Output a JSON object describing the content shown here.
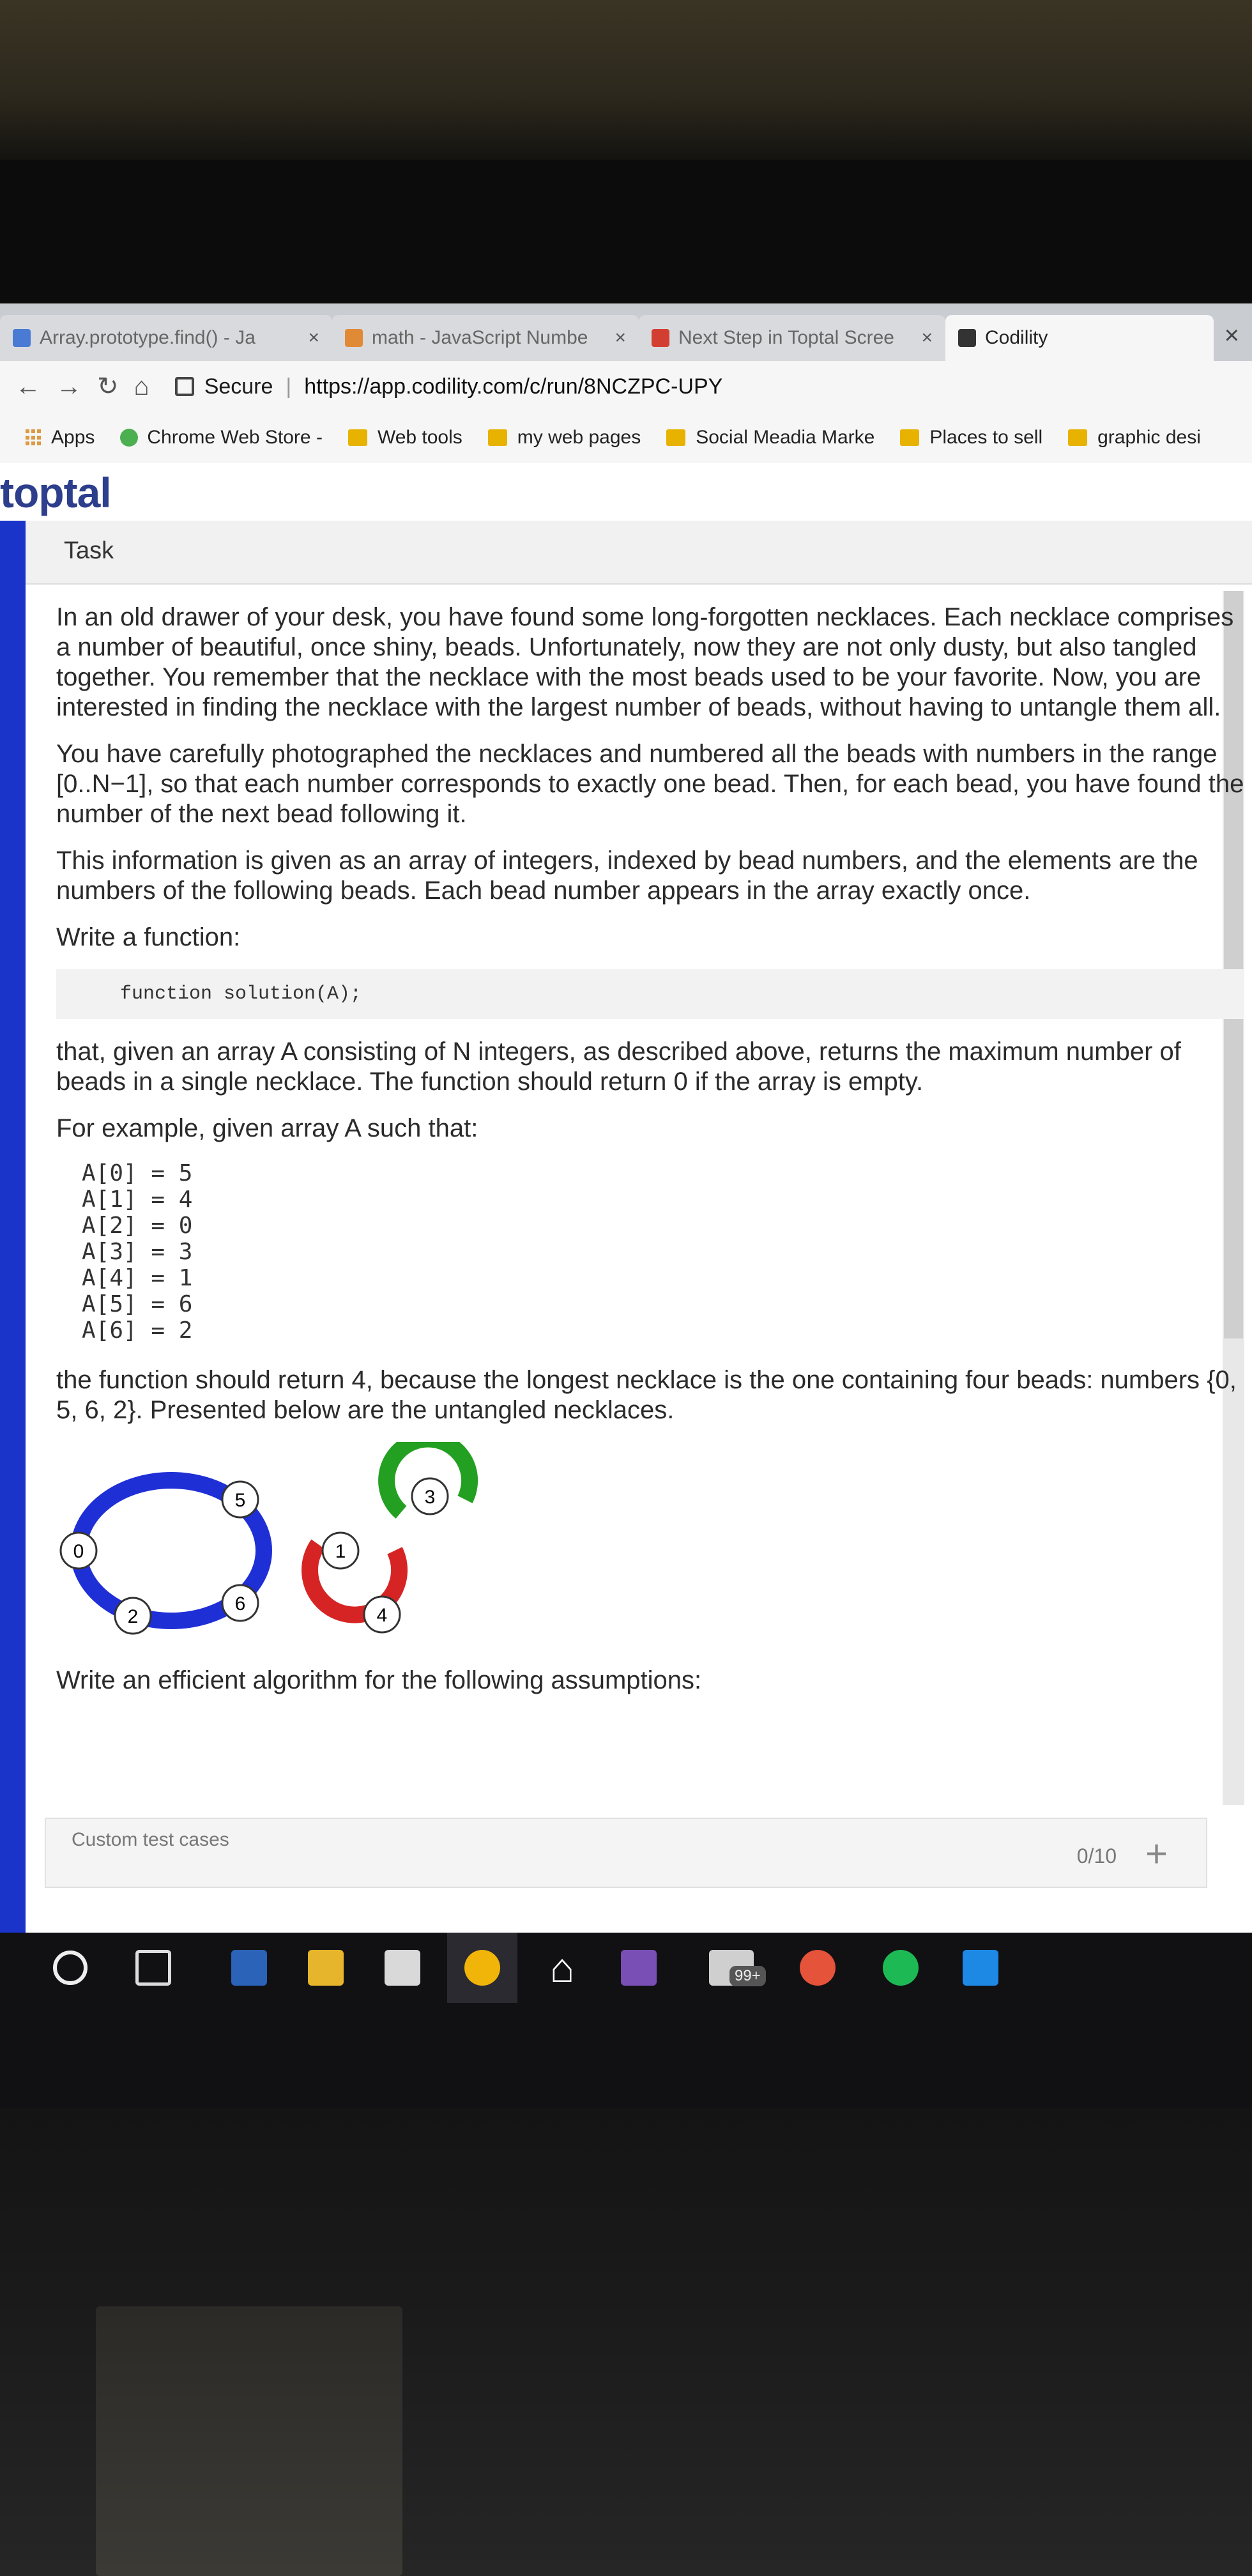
{
  "browser": {
    "tabs": [
      {
        "label": "Array.prototype.find() - Ja",
        "close": "×"
      },
      {
        "label": "math - JavaScript Numbe",
        "close": "×"
      },
      {
        "label": "Next Step in Toptal Scree",
        "close": "×"
      },
      {
        "label": "Codility",
        "close": ""
      }
    ],
    "window_close": "×",
    "secure_label": "Secure",
    "url": "https://app.codility.com/c/run/8NCZPC-UPY"
  },
  "bookmarks": [
    {
      "label": "Apps",
      "icon": "apps-grid-icon"
    },
    {
      "label": "Chrome Web Store -",
      "icon": "chrome-store-icon"
    },
    {
      "label": "Web tools",
      "icon": "folder-icon"
    },
    {
      "label": "my web pages",
      "icon": "folder-icon"
    },
    {
      "label": "Social Meadia Marke",
      "icon": "folder-icon"
    },
    {
      "label": "Places to sell",
      "icon": "folder-icon"
    },
    {
      "label": "graphic desi",
      "icon": "folder-icon"
    }
  ],
  "page": {
    "logo": "toptal",
    "task_header": "Task",
    "paragraphs": [
      "In an old drawer of your desk, you have found some long-forgotten necklaces. Each necklace comprises a number of beautiful, once shiny, beads. Unfortunately, now they are not only dusty, but also tangled together. You remember that the necklace with the most beads used to be your favorite. Now, you are interested in finding the necklace with the largest number of beads, without having to untangle them all.",
      "You have carefully photographed the necklaces and numbered all the beads with numbers in the range [0..N−1], so that each number corresponds to exactly one bead. Then, for each bead, you have found the number of the next bead following it.",
      "This information is given as an array of integers, indexed by bead numbers, and the elements are the numbers of the following beads. Each bead number appears in the array exactly once.",
      "Write a function:"
    ],
    "code_signature": "function solution(A);",
    "paragraphs2": [
      "that, given an array A consisting of N integers, as described above, returns the maximum number of beads in a single necklace. The function should return 0 if the array is empty.",
      "For example, given array A such that:"
    ],
    "array_lines": [
      "A[0] = 5",
      "A[1] = 4",
      "A[2] = 0",
      "A[3] = 3",
      "A[4] = 1",
      "A[5] = 6",
      "A[6] = 2"
    ],
    "result_text": "the function should return 4, because the longest necklace is the one containing four beads: numbers {0, 5, 6, 2}. Presented below are the untangled necklaces.",
    "bead_labels": [
      "0",
      "5",
      "6",
      "2",
      "1",
      "4",
      "3"
    ],
    "necklace_colors": [
      "#1f2fd6",
      "#d62424",
      "#23a021"
    ],
    "assumptions_text": "Write an efficient algorithm for the following assumptions:",
    "custom_tests_label": "Custom test cases",
    "custom_tests_count": "0/10",
    "add_test": "+"
  },
  "taskbar_icons": [
    "cortana-circle-icon",
    "task-view-icon",
    "powershell-icon",
    "file-explorer-icon",
    "store-icon",
    "chrome-icon",
    "home-icon",
    "media-icon",
    "mail-icon",
    "camera-icon",
    "spotify-icon",
    "vscode-icon"
  ],
  "taskbar_badge": "99+"
}
